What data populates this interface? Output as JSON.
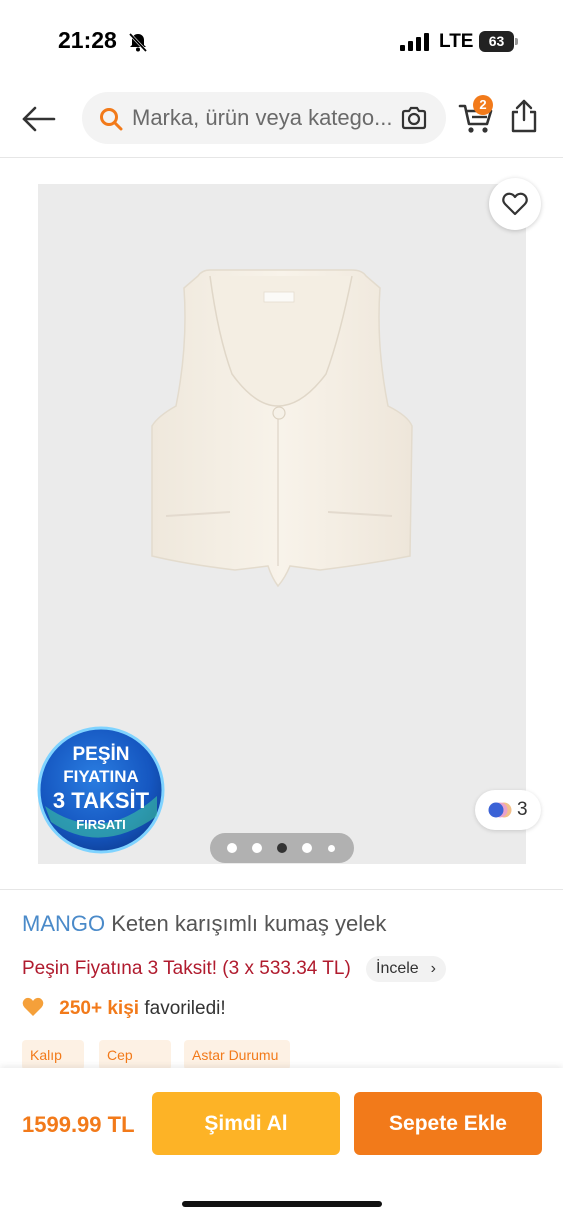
{
  "status_bar": {
    "time": "21:28",
    "network": "LTE",
    "battery": "63"
  },
  "top_nav": {
    "search_placeholder": "Marka, ürün veya katego...",
    "cart_count": "2"
  },
  "product_image": {
    "promo_badge_lines": [
      "PEŞİN",
      "FIYATINA",
      "3 TAKSİT",
      "FIRSATI"
    ],
    "color_count": "3",
    "gallery_pages": 5,
    "gallery_active_page": 3
  },
  "product": {
    "brand": "MANGO",
    "name": "Keten karışımlı kumaş yelek",
    "installment_text": "Peşin Fiyatına 3 Taksit! (3 x 533.34 TL)",
    "incele_label": "İncele",
    "favorites_count": "250+ kişi",
    "favorites_suffix": "favoriledi!",
    "chips": [
      "Kalıp",
      "Cep",
      "Astar Durumu"
    ]
  },
  "bottom_bar": {
    "price": "1599.99 TL",
    "buy_now_label": "Şimdi Al",
    "add_to_cart_label": "Sepete Ekle"
  },
  "colors": {
    "accent": "#f27a1a",
    "brand_blue": "#4a8ac9",
    "installment_red": "#b01b2e",
    "buy_now": "#fdb326"
  }
}
